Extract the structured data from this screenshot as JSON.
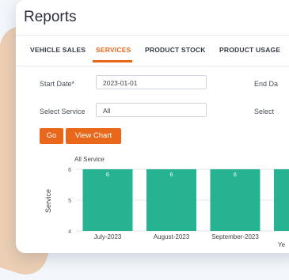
{
  "header": {
    "title": "Reports"
  },
  "tabs": [
    {
      "label": "VEHICLE SALES"
    },
    {
      "label": "SERVICES"
    },
    {
      "label": "PRODUCT STOCK"
    },
    {
      "label": "PRODUCT USAGE"
    }
  ],
  "active_tab": "SERVICES",
  "form": {
    "start_date_label": "Start Date*",
    "start_date_value": "2023-01-01",
    "end_date_label": "End Da",
    "select_service_label": "Select Service",
    "select_service_value": "All",
    "select_right_label": "Select"
  },
  "buttons": {
    "go": "Go",
    "view_chart": "View Chart"
  },
  "colors": {
    "accent": "#e8671b",
    "bar": "#26b391"
  },
  "chart_data": {
    "type": "bar",
    "title": "All Service",
    "ylabel": "Service",
    "xlabel": "Ye",
    "ylim": [
      4,
      6
    ],
    "yticks": [
      "6",
      "5",
      "4"
    ],
    "categories": [
      "July-2023",
      "August-2023",
      "September-2023",
      ""
    ],
    "values": [
      6,
      6,
      6,
      6
    ],
    "value_labels": [
      "6",
      "6",
      "6",
      ""
    ]
  }
}
